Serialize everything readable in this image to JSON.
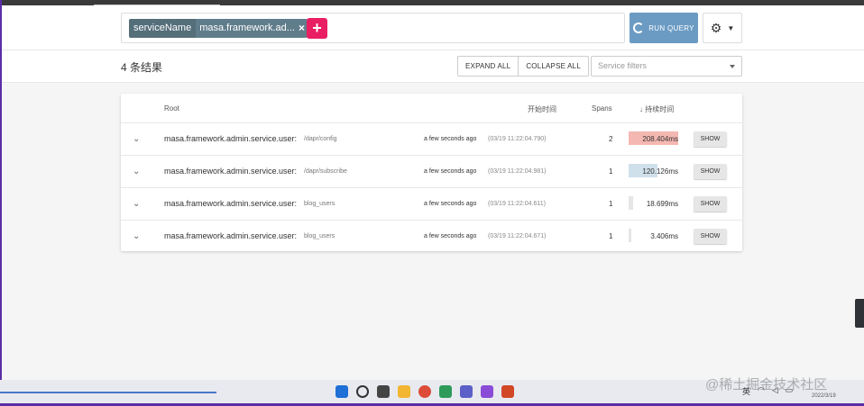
{
  "query": {
    "chip_key": "serviceName",
    "chip_value": "masa.framework.ad...",
    "chip_close": "×",
    "add_label": "+",
    "run_label": "RUN QUERY",
    "settings_icon": "⚙"
  },
  "toolbar": {
    "results_count": "4 条结果",
    "expand_all": "EXPAND ALL",
    "collapse_all": "COLLAPSE ALL",
    "filters_placeholder": "Service filters"
  },
  "table": {
    "headers": {
      "root": "Root",
      "start_time": "开始时间",
      "spans": "Spans",
      "duration": "↓  持续时间"
    },
    "rows": [
      {
        "service": "masa.framework.admin.service.user:",
        "operation": "/dapr/config",
        "ago": "a few seconds ago",
        "timestamp": "(03/19 11:22:04.790)",
        "spans": "2",
        "duration": "208.404ms",
        "duration_fraction": 1.0,
        "bar_color": "#f4b7b2",
        "show": "SHOW"
      },
      {
        "service": "masa.framework.admin.service.user:",
        "operation": "/dapr/subscribe",
        "ago": "a few seconds ago",
        "timestamp": "(03/19 11:22:04.981)",
        "spans": "1",
        "duration": "120.126ms",
        "duration_fraction": 0.577,
        "bar_color": "#cfe0ea",
        "show": "SHOW"
      },
      {
        "service": "masa.framework.admin.service.user:",
        "operation": "blog_users",
        "ago": "a few seconds ago",
        "timestamp": "(03/19 11:22:04.611)",
        "spans": "1",
        "duration": "18.699ms",
        "duration_fraction": 0.09,
        "bar_color": "#e6e6e6",
        "show": "SHOW"
      },
      {
        "service": "masa.framework.admin.service.user:",
        "operation": "blog_users",
        "ago": "a few seconds ago",
        "timestamp": "(03/19 11:22:04.671)",
        "spans": "1",
        "duration": "3.406ms",
        "duration_fraction": 0.016,
        "bar_color": "#e6e6e6",
        "show": "SHOW"
      }
    ]
  },
  "taskbar": {
    "watermark": "@稀土掘金技术社区",
    "date": "2022/3/19",
    "tray_lang": "英"
  }
}
